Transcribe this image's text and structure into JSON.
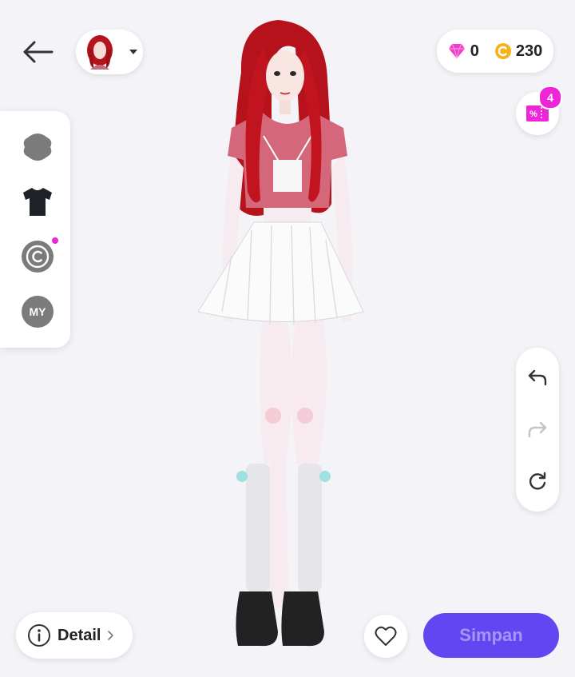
{
  "header": {
    "back_icon": "arrow-left-icon",
    "avatar_icon": "avatar-thumbnail",
    "dropdown_icon": "caret-down-icon"
  },
  "currency": {
    "gems": "0",
    "coins": "230",
    "gem_icon": "diamond-icon",
    "coin_icon": "coin-icon"
  },
  "promo": {
    "badge": "4",
    "icon": "coupon-icon"
  },
  "categories": [
    {
      "id": "face",
      "icon": "head-icon"
    },
    {
      "id": "clothes",
      "icon": "tshirt-icon"
    },
    {
      "id": "creator",
      "icon": "copyright-icon"
    },
    {
      "id": "my",
      "label": "MY"
    }
  ],
  "history": {
    "undo_icon": "undo-icon",
    "redo_icon": "redo-icon",
    "reset_icon": "refresh-icon"
  },
  "footer": {
    "detail_label": "Detail",
    "save_label": "Simpan",
    "favorite_icon": "heart-icon"
  },
  "colors": {
    "background": "#f4f4f8",
    "accent_pink": "#ee25d9",
    "save_button": "#6146f2",
    "save_text": "#a795f7",
    "coin": "#f7b21a",
    "gem": "#f03cc8"
  }
}
